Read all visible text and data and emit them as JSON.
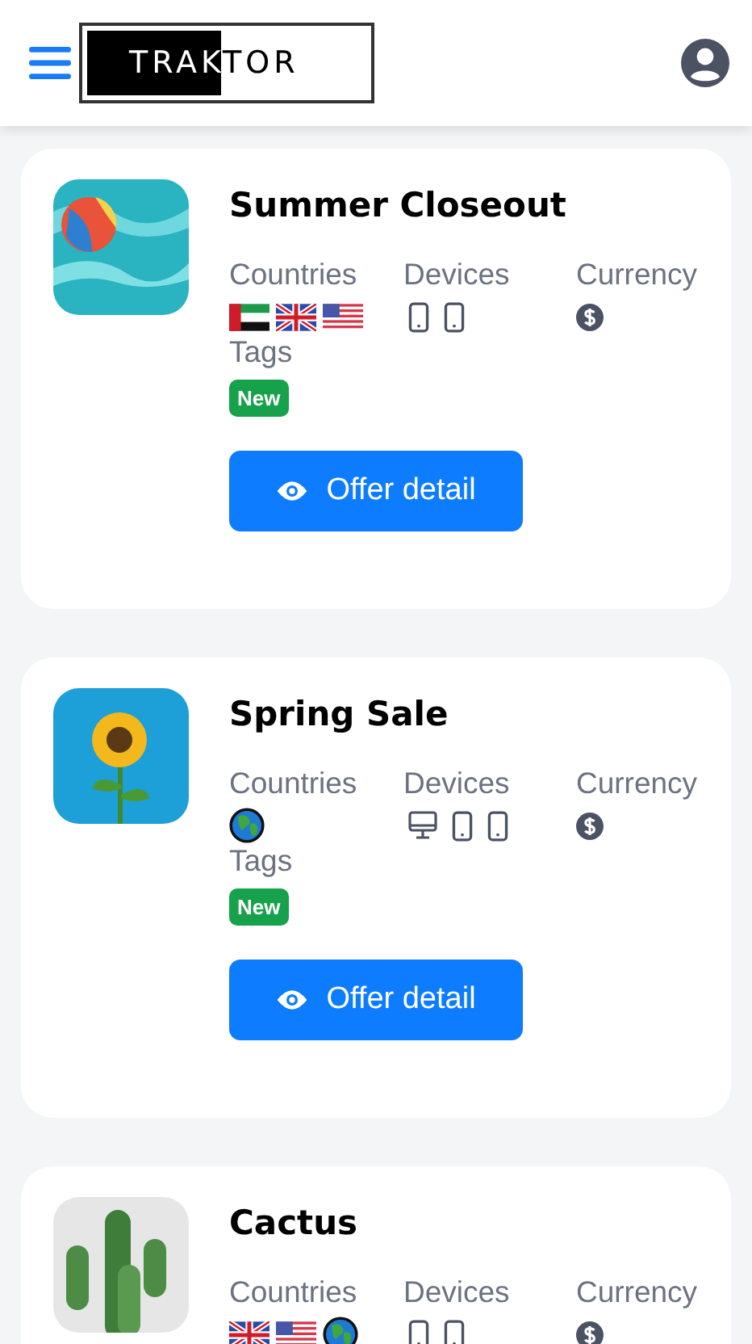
{
  "header": {
    "logo": "TRAKTOR"
  },
  "offers": [
    {
      "title": "Summer Closeout",
      "labels": {
        "countries": "Countries",
        "devices": "Devices",
        "currency": "Currency",
        "tags": "Tags"
      },
      "countries": [
        {
          "kind": "ae"
        },
        {
          "kind": "gb"
        },
        {
          "kind": "us"
        }
      ],
      "devices": [
        {
          "kind": "mobile"
        },
        {
          "kind": "mobile"
        }
      ],
      "currency": [
        {
          "kind": "dollar"
        }
      ],
      "tags": [
        "New"
      ],
      "button": "Offer detail"
    },
    {
      "title": "Spring Sale",
      "labels": {
        "countries": "Countries",
        "devices": "Devices",
        "currency": "Currency",
        "tags": "Tags"
      },
      "countries": [
        {
          "kind": "world"
        }
      ],
      "devices": [
        {
          "kind": "desktop"
        },
        {
          "kind": "mobile"
        },
        {
          "kind": "mobile"
        }
      ],
      "currency": [
        {
          "kind": "dollar"
        }
      ],
      "tags": [
        "New"
      ],
      "button": "Offer detail"
    },
    {
      "title": "Cactus",
      "labels": {
        "countries": "Countries",
        "devices": "Devices",
        "currency": "Currency"
      },
      "countries": [
        {
          "kind": "gb"
        },
        {
          "kind": "us"
        },
        {
          "kind": "world"
        }
      ],
      "devices": [
        {
          "kind": "mobile"
        },
        {
          "kind": "mobile"
        }
      ],
      "currency": [
        {
          "kind": "dollar"
        }
      ]
    }
  ]
}
